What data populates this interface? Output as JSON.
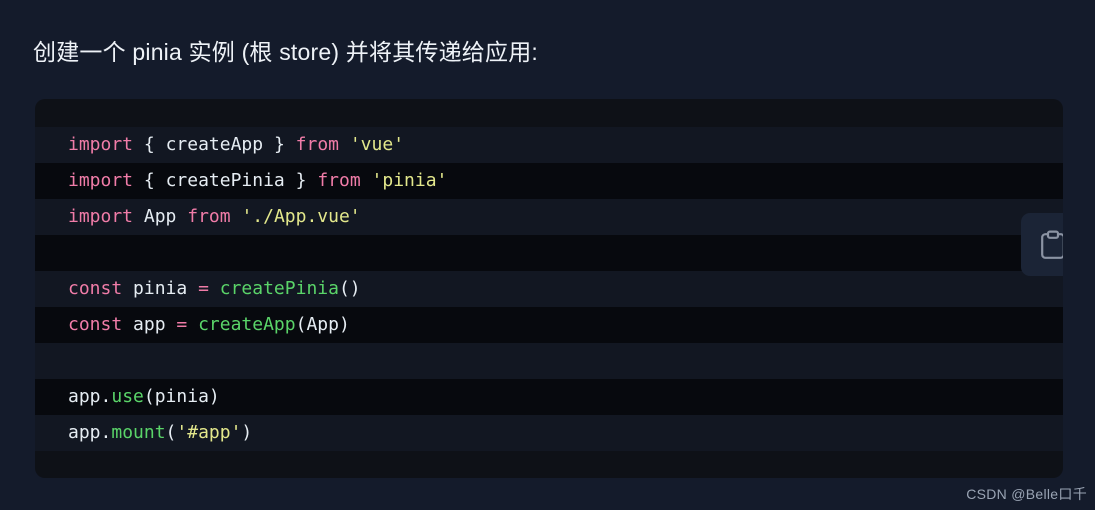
{
  "page": {
    "background_color": "#141b2b",
    "title": "创建一个 pinia 实例 (根 store) 并将其传递给应用:"
  },
  "code_block": {
    "background_color": "#0e1117",
    "language": "javascript",
    "stripe_colors": [
      "#121722",
      "#07090e"
    ],
    "copy_button": {
      "icon": "clipboard-icon",
      "background_color": "#1b2436",
      "icon_color": "#8b93a3"
    },
    "lines": [
      {
        "index": 1,
        "text": "import { createApp } from 'vue'",
        "tokens": [
          {
            "t": "import",
            "c": "kw"
          },
          {
            "t": " ",
            "c": "punc"
          },
          {
            "t": "{",
            "c": "punc"
          },
          {
            "t": " ",
            "c": "punc"
          },
          {
            "t": "createApp",
            "c": "id"
          },
          {
            "t": " ",
            "c": "punc"
          },
          {
            "t": "}",
            "c": "punc"
          },
          {
            "t": " ",
            "c": "punc"
          },
          {
            "t": "from",
            "c": "kw"
          },
          {
            "t": " ",
            "c": "punc"
          },
          {
            "t": "'vue'",
            "c": "str"
          }
        ]
      },
      {
        "index": 2,
        "text": "import { createPinia } from 'pinia'",
        "tokens": [
          {
            "t": "import",
            "c": "kw"
          },
          {
            "t": " ",
            "c": "punc"
          },
          {
            "t": "{",
            "c": "punc"
          },
          {
            "t": " ",
            "c": "punc"
          },
          {
            "t": "createPinia",
            "c": "id"
          },
          {
            "t": " ",
            "c": "punc"
          },
          {
            "t": "}",
            "c": "punc"
          },
          {
            "t": " ",
            "c": "punc"
          },
          {
            "t": "from",
            "c": "kw"
          },
          {
            "t": " ",
            "c": "punc"
          },
          {
            "t": "'pinia'",
            "c": "str"
          }
        ]
      },
      {
        "index": 3,
        "text": "import App from './App.vue'",
        "tokens": [
          {
            "t": "import",
            "c": "kw"
          },
          {
            "t": " ",
            "c": "punc"
          },
          {
            "t": "App",
            "c": "id"
          },
          {
            "t": " ",
            "c": "punc"
          },
          {
            "t": "from",
            "c": "kw"
          },
          {
            "t": " ",
            "c": "punc"
          },
          {
            "t": "'./App.vue'",
            "c": "str"
          }
        ]
      },
      {
        "index": 4,
        "text": "",
        "tokens": []
      },
      {
        "index": 5,
        "text": "const pinia = createPinia()",
        "tokens": [
          {
            "t": "const",
            "c": "kw"
          },
          {
            "t": " ",
            "c": "punc"
          },
          {
            "t": "pinia",
            "c": "id"
          },
          {
            "t": " ",
            "c": "punc"
          },
          {
            "t": "=",
            "c": "kw"
          },
          {
            "t": " ",
            "c": "punc"
          },
          {
            "t": "createPinia",
            "c": "fn"
          },
          {
            "t": "()",
            "c": "punc"
          }
        ]
      },
      {
        "index": 6,
        "text": "const app = createApp(App)",
        "tokens": [
          {
            "t": "const",
            "c": "kw"
          },
          {
            "t": " ",
            "c": "punc"
          },
          {
            "t": "app",
            "c": "id"
          },
          {
            "t": " ",
            "c": "punc"
          },
          {
            "t": "=",
            "c": "kw"
          },
          {
            "t": " ",
            "c": "punc"
          },
          {
            "t": "createApp",
            "c": "fn"
          },
          {
            "t": "(",
            "c": "punc"
          },
          {
            "t": "App",
            "c": "id"
          },
          {
            "t": ")",
            "c": "punc"
          }
        ]
      },
      {
        "index": 7,
        "text": "",
        "tokens": []
      },
      {
        "index": 8,
        "text": "app.use(pinia)",
        "tokens": [
          {
            "t": "app",
            "c": "id"
          },
          {
            "t": ".",
            "c": "punc"
          },
          {
            "t": "use",
            "c": "fn"
          },
          {
            "t": "(",
            "c": "punc"
          },
          {
            "t": "pinia",
            "c": "id"
          },
          {
            "t": ")",
            "c": "punc"
          }
        ]
      },
      {
        "index": 9,
        "text": "app.mount('#app')",
        "tokens": [
          {
            "t": "app",
            "c": "id"
          },
          {
            "t": ".",
            "c": "punc"
          },
          {
            "t": "mount",
            "c": "fn"
          },
          {
            "t": "(",
            "c": "punc"
          },
          {
            "t": "'#app'",
            "c": "str"
          },
          {
            "t": ")",
            "c": "punc"
          }
        ]
      }
    ]
  },
  "watermark": {
    "text": "CSDN @Belle口千"
  },
  "syntax_colors": {
    "keyword": "#f07ca8",
    "function": "#5ad469",
    "string": "#e3e88c",
    "identifier": "#e6edf3"
  }
}
